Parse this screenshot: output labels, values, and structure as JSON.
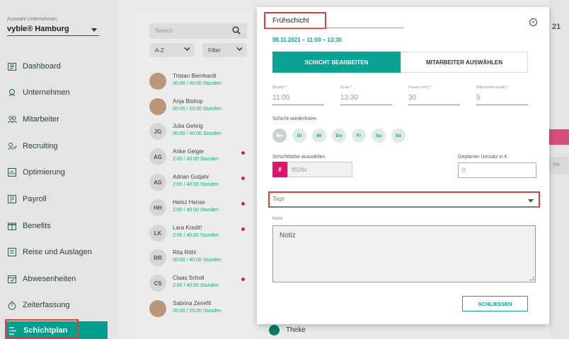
{
  "sidebar": {
    "company_label": "Auswahl Unternehmen",
    "company": "vyble® Hamburg",
    "items": [
      {
        "label": "Dashboard",
        "icon": "dashboard-icon"
      },
      {
        "label": "Unternehmen",
        "icon": "company-icon"
      },
      {
        "label": "Mitarbeiter",
        "icon": "people-icon"
      },
      {
        "label": "Recruiting",
        "icon": "recruiting-icon"
      },
      {
        "label": "Optimierung",
        "icon": "optimization-icon"
      },
      {
        "label": "Payroll",
        "icon": "payroll-icon"
      },
      {
        "label": "Benefits",
        "icon": "gift-icon"
      },
      {
        "label": "Reise und Auslagen",
        "icon": "receipt-icon"
      },
      {
        "label": "Abwesenheiten",
        "icon": "calendar-icon"
      },
      {
        "label": "Zeiterfassung",
        "icon": "stopwatch-icon"
      },
      {
        "label": "Schichtplan",
        "icon": "list-icon"
      }
    ],
    "active_item": "Schichtplan"
  },
  "employee_list": {
    "search_placeholder": "Search",
    "sort_value": "A-Z",
    "filter_label": "Filter",
    "employees": [
      {
        "initials": "",
        "photo": true,
        "name": "Tristan Bernhardt",
        "hours": "00:00 / 40:00 Stunden",
        "flag": false
      },
      {
        "initials": "",
        "photo": true,
        "name": "Anja Bishop",
        "hours": "00:00 / 20:00 Stunden",
        "flag": false
      },
      {
        "initials": "JG",
        "photo": false,
        "name": "Julia Gehrig",
        "hours": "00:00 / 40:00 Stunden",
        "flag": false
      },
      {
        "initials": "AG",
        "photo": false,
        "name": "Anke Geiger",
        "hours": "2:00 / 40:00 Stunden",
        "flag": true
      },
      {
        "initials": "AG",
        "photo": false,
        "name": "Adrian Gutjahr",
        "hours": "2:00 / 40:00 Stunden",
        "flag": true
      },
      {
        "initials": "HH",
        "photo": false,
        "name": "Heinz Hense",
        "hours": "2:00 / 40:00 Stunden",
        "flag": true
      },
      {
        "initials": "LK",
        "photo": false,
        "name": "Lara Kredit!",
        "hours": "2:00 / 40:00 Stunden",
        "flag": true
      },
      {
        "initials": "RR",
        "photo": false,
        "name": "Rita Röhl",
        "hours": "00:00 / 40:00 Stunden",
        "flag": false
      },
      {
        "initials": "CS",
        "photo": false,
        "name": "Claas Scholl",
        "hours": "2:00 / 40:00 Stunden",
        "flag": true
      },
      {
        "initials": "",
        "photo": true,
        "name": "Sabrina Zenefit",
        "hours": "00:00 / 25:00 Stunden",
        "flag": false
      }
    ]
  },
  "background": {
    "calendar_num": "21",
    "side_label": "SN",
    "legend_label": "Theke"
  },
  "modal": {
    "title": "Frühschicht",
    "date_range": "08.11.2021 – 11:00 – 13:30",
    "tab_active": "SCHICHT BEARBEITEN",
    "tab_inactive": "MITARBEITER AUSWÄHLEN",
    "fields": {
      "begin_label": "Beginn *",
      "begin_value": "11:00",
      "end_label": "Ende *",
      "end_value": "13:30",
      "pause_label": "Pause (min) *",
      "pause_value": "30",
      "count_label": "Mitarbeiteranzahl *",
      "count_value": "5"
    },
    "repeat_label": "Schicht wiederholen",
    "days": [
      "Mo",
      "Di",
      "Mi",
      "Do",
      "Fr",
      "Sa",
      "So"
    ],
    "color_label": "Schichtfarbe auswählen",
    "color_hash": "#",
    "color_value": "ff026c",
    "revenue_label": "Geplanter Umsatz in €",
    "revenue_value": "0",
    "tags_placeholder": "Tags",
    "notes_label": "Notiz",
    "notes_placeholder": "Notiz",
    "close_button": "SCHLIESSEN",
    "close_icon": "close-circle-icon"
  },
  "colors": {
    "accent": "#0aa393",
    "shift_color": "#ff026c",
    "highlight": "#e53935"
  }
}
